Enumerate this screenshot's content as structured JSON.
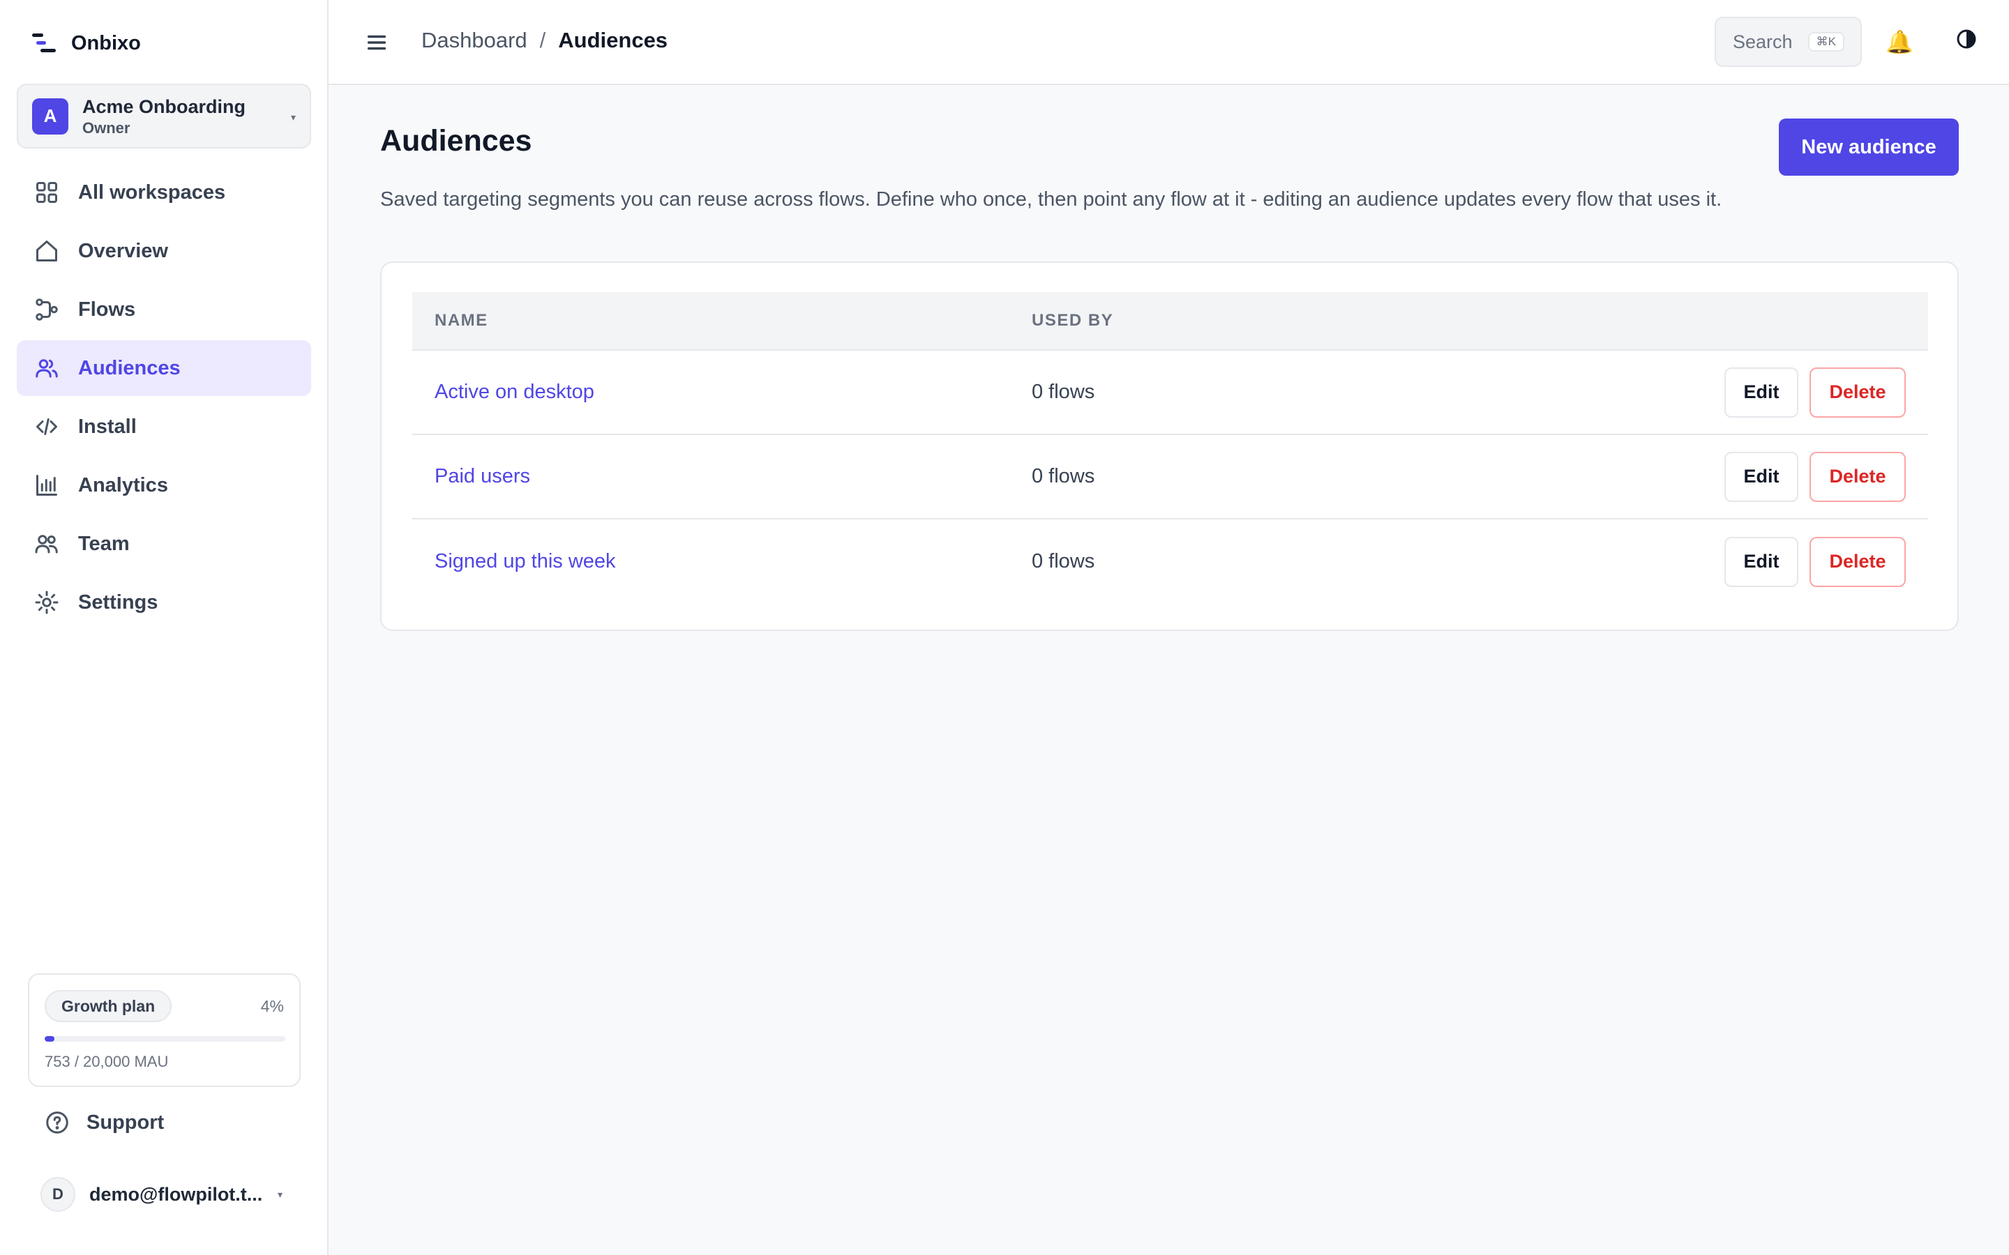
{
  "brand": {
    "name": "Onbixo"
  },
  "workspace": {
    "initial": "A",
    "name": "Acme Onboarding",
    "role": "Owner"
  },
  "nav": {
    "items": [
      {
        "label": "All workspaces",
        "icon": "grid-icon"
      },
      {
        "label": "Overview",
        "icon": "home-icon"
      },
      {
        "label": "Flows",
        "icon": "flow-icon"
      },
      {
        "label": "Audiences",
        "icon": "users-icon",
        "active": true
      },
      {
        "label": "Install",
        "icon": "code-icon"
      },
      {
        "label": "Analytics",
        "icon": "bar-chart-icon"
      },
      {
        "label": "Team",
        "icon": "team-icon"
      },
      {
        "label": "Settings",
        "icon": "gear-icon"
      }
    ]
  },
  "plan": {
    "name": "Growth plan",
    "percent_label": "4%",
    "percent": 0.04,
    "usage": "753 / 20,000 MAU"
  },
  "support": {
    "label": "Support"
  },
  "user": {
    "initial": "D",
    "email": "demo@flowpilot.t..."
  },
  "topbar": {
    "breadcrumb": {
      "parent": "Dashboard",
      "separator": "/",
      "current": "Audiences"
    },
    "search": {
      "label": "Search",
      "shortcut": "⌘K"
    },
    "bell": "🔔"
  },
  "main": {
    "title": "Audiences",
    "new_button": "New audience",
    "description": "Saved targeting segments you can reuse across flows. Define who once, then point any flow at it - editing an audience updates every flow that uses it.",
    "table": {
      "columns": [
        "NAME",
        "USED BY"
      ],
      "rows": [
        {
          "name": "Active on desktop",
          "used_by": "0 flows",
          "edit": "Edit",
          "delete": "Delete"
        },
        {
          "name": "Paid users",
          "used_by": "0 flows",
          "edit": "Edit",
          "delete": "Delete"
        },
        {
          "name": "Signed up this week",
          "used_by": "0 flows",
          "edit": "Edit",
          "delete": "Delete"
        }
      ]
    }
  },
  "colors": {
    "accent": "#4f46e5",
    "danger": "#dc2626",
    "active_bg": "#ede9fe"
  }
}
